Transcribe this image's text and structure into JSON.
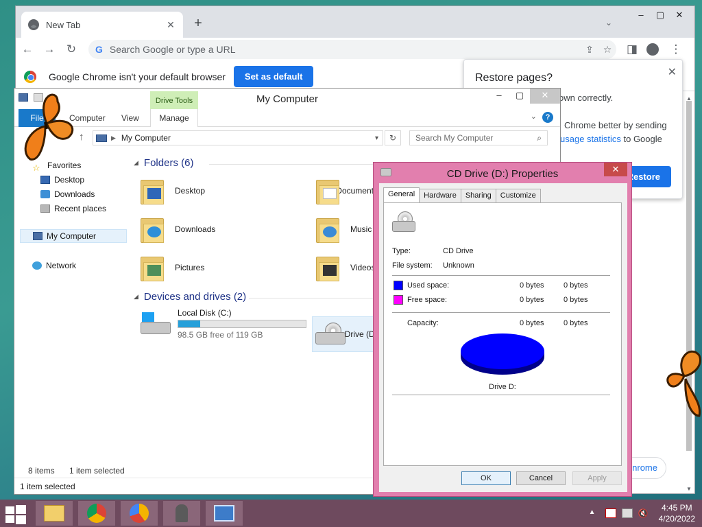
{
  "chrome": {
    "tab_title": "New Tab",
    "tab_close": "✕",
    "new_tab": "+",
    "tab_search": "⌄",
    "win_controls": [
      "–",
      "▢",
      "✕"
    ],
    "omnibox_placeholder": "Search Google or type a URL",
    "infobar_message": "Google Chrome isn't your default browser",
    "set_default_label": "Set as default",
    "restore": {
      "title": "Restore pages?",
      "close": "✕",
      "line1": "own correctly.",
      "line2": "Chrome better by sending",
      "line3_link": "usage statistics",
      "line3_rest": " to Google",
      "button": "Restore"
    },
    "pill_text": "nrome"
  },
  "explorer": {
    "title": "My Computer",
    "context_tab": "Drive Tools",
    "ribbon_tabs": [
      "File",
      "Computer",
      "View",
      "Manage"
    ],
    "address": "My Computer",
    "search_placeholder": "Search My Computer",
    "nav": {
      "favorites": "Favorites",
      "desktop": "Desktop",
      "downloads": "Downloads",
      "recent": "Recent places",
      "my_computer": "My Computer",
      "network": "Network"
    },
    "folders_header": "Folders (6)",
    "folders": [
      "Desktop",
      "Documents",
      "Downloads",
      "Music",
      "Pictures",
      "Videos"
    ],
    "drives_header": "Devices and drives (2)",
    "local_disk": {
      "name": "Local Disk (C:)",
      "free": "98.5 GB free of 119 GB",
      "used_fraction": 0.17
    },
    "cd_drive_label": "CD Drive (D:)",
    "items_count": "8 items",
    "selected": "1 item selected",
    "status_bar": "1 item selected"
  },
  "properties": {
    "title": "CD Drive (D:) Properties",
    "close": "✕",
    "tabs": [
      "General",
      "Hardware",
      "Sharing",
      "Customize"
    ],
    "type_label": "Type:",
    "type_value": "CD Drive",
    "fs_label": "File system:",
    "fs_value": "Unknown",
    "used_label": "Used space:",
    "used_bytes": "0 bytes",
    "used_bytes2": "0 bytes",
    "free_label": "Free space:",
    "free_bytes": "0 bytes",
    "free_bytes2": "0 bytes",
    "capacity_label": "Capacity:",
    "capacity_bytes": "0 bytes",
    "capacity_bytes2": "0 bytes",
    "drive_caption": "Drive D:",
    "used_color": "#0000ff",
    "free_color": "#ff00ff",
    "buttons": {
      "ok": "OK",
      "cancel": "Cancel",
      "apply": "Apply"
    }
  },
  "taskbar": {
    "time": "4:45 PM",
    "date": "4/20/2022"
  }
}
